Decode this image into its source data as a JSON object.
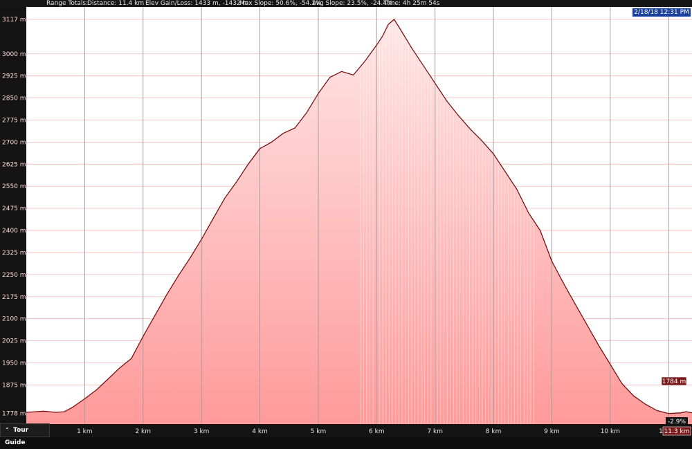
{
  "header": {
    "range_totals": "Range Totals:",
    "distance": "Distance: 11.4 km",
    "elev_gain_loss": "Elev Gain/Loss: 1433 m, -1432 m",
    "max_slope": "Max Slope: 50.6%, -54.1%",
    "avg_slope": "Avg Slope: 23.5%, -24.4%",
    "time": "Time: 4h 25m 54s"
  },
  "date_badge": "2/18/18 12:31 PM",
  "tour_guide": {
    "icon": "double-chevron-up-icon",
    "label": "Tour Guide"
  },
  "cursor": {
    "elevation_label": "1784 m",
    "slope_label": "-2.9%",
    "distance_label": "11.3 km"
  },
  "colors": {
    "fill_top": "#ffe6e6",
    "fill_bottom": "#ff9a9a",
    "line": "#7a1010",
    "badge_elev": "#7a1a1a",
    "date_badge": "#1a3f9c"
  },
  "chart_data": {
    "type": "area",
    "title": "",
    "xlabel": "",
    "ylabel": "",
    "x_unit": "km",
    "y_unit": "m",
    "xlim": [
      0,
      11.4
    ],
    "ylim": [
      1742,
      3117
    ],
    "grid": true,
    "x_ticks": [
      1,
      2,
      3,
      4,
      5,
      6,
      7,
      8,
      9,
      10,
      11
    ],
    "x_tick_labels": [
      "1 km",
      "2 km",
      "3 km",
      "4 km",
      "5 km",
      "6 km",
      "7 km",
      "8 km",
      "9 km",
      "10 km",
      "11 km"
    ],
    "y_ticks": [
      1778,
      1875,
      1950,
      2025,
      2100,
      2175,
      2250,
      2325,
      2400,
      2475,
      2550,
      2625,
      2700,
      2775,
      2850,
      2925,
      3000,
      3117
    ],
    "y_tick_labels": [
      "1778 m",
      "1875 m",
      "1950 m",
      "2025 m",
      "2100 m",
      "2175 m",
      "2250 m",
      "2325 m",
      "2400 m",
      "2475 m",
      "2550 m",
      "2625 m",
      "2700 m",
      "2775 m",
      "2850 m",
      "2925 m",
      "3000 m",
      "3117 m"
    ],
    "series": [
      {
        "x": [
          0,
          0.3,
          0.5,
          0.65,
          0.8,
          1.0,
          1.2,
          1.4,
          1.6,
          1.8,
          2.0,
          2.2,
          2.4,
          2.6,
          2.8,
          3.0,
          3.2,
          3.4,
          3.6,
          3.8,
          4.0,
          4.2,
          4.4,
          4.6,
          4.8,
          5.0,
          5.2,
          5.4,
          5.6,
          5.8,
          6.0,
          6.1,
          6.2,
          6.3,
          6.4,
          6.6,
          6.8,
          7.0,
          7.2,
          7.4,
          7.6,
          7.8,
          8.0,
          8.2,
          8.4,
          8.6,
          8.8,
          9.0,
          9.2,
          9.4,
          9.6,
          9.8,
          10.0,
          10.2,
          10.4,
          10.6,
          10.8,
          11.0,
          11.2,
          11.3,
          11.4
        ],
        "y": [
          1782,
          1786,
          1782,
          1784,
          1800,
          1828,
          1858,
          1895,
          1933,
          1965,
          2040,
          2110,
          2180,
          2245,
          2305,
          2370,
          2440,
          2510,
          2565,
          2625,
          2678,
          2700,
          2730,
          2748,
          2800,
          2865,
          2920,
          2940,
          2928,
          2975,
          3030,
          3060,
          3100,
          3117,
          3085,
          3020,
          2960,
          2900,
          2840,
          2790,
          2745,
          2705,
          2660,
          2600,
          2540,
          2460,
          2400,
          2295,
          2220,
          2150,
          2080,
          2010,
          1945,
          1880,
          1838,
          1810,
          1788,
          1778,
          1780,
          1784,
          1780
        ]
      }
    ]
  }
}
